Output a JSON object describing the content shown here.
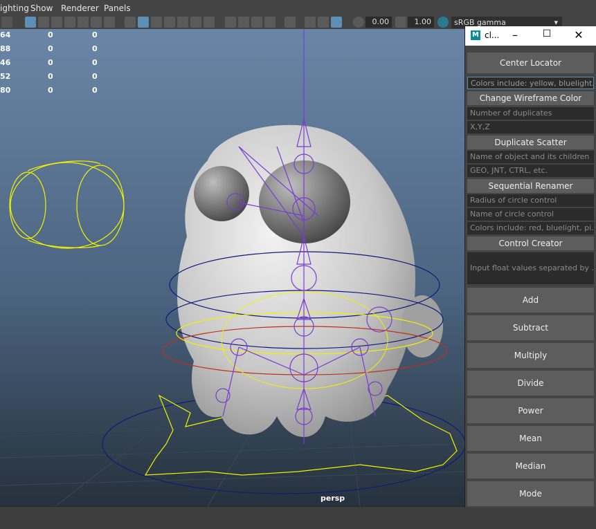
{
  "menu": {
    "lighting": "ighting",
    "show": "Show",
    "renderer": "Renderer",
    "panels": "Panels"
  },
  "toolbar": {
    "exposure": "0.00",
    "gamma": "1.00",
    "color_space": "sRGB gamma"
  },
  "hud": {
    "rows": [
      {
        "a": "64",
        "b": "0",
        "c": "0"
      },
      {
        "a": "88",
        "b": "0",
        "c": "0"
      },
      {
        "a": "46",
        "b": "0",
        "c": "0"
      },
      {
        "a": "52",
        "b": "0",
        "c": "0"
      },
      {
        "a": "80",
        "b": "0",
        "c": "0"
      }
    ]
  },
  "viewport": {
    "camera_label": "persp"
  },
  "window": {
    "title": "cl...",
    "center_locator": "Center Locator",
    "color_field_placeholder": "Colors include: yellow, bluelight...",
    "change_wire_color": "Change Wireframe Color",
    "dup_count_placeholder": "Number of duplicates",
    "xyz_placeholder": "X,Y,Z",
    "dup_scatter": "Duplicate Scatter",
    "obj_name_placeholder": "Name of object and its children",
    "suffix_placeholder": "GEO, JNT, CTRL, etc.",
    "seq_renamer": "Sequential Renamer",
    "radius_placeholder": "Radius of circle control",
    "circle_name_placeholder": "Name of circle control",
    "ctrl_color_placeholder": "Colors include: red, bluelight, pi...",
    "control_creator": "Control Creator",
    "float_placeholder": "Input float values separated by ...",
    "math": [
      "Add",
      "Subtract",
      "Multiply",
      "Divide",
      "Power",
      "Mean",
      "Median",
      "Mode"
    ]
  },
  "colors": {
    "accent": "#5c8fb5",
    "wire_yellow": "#f2f200",
    "wire_purple": "#7a3cd0",
    "wire_blue": "#101a7a",
    "wire_red": "#c0301a"
  }
}
